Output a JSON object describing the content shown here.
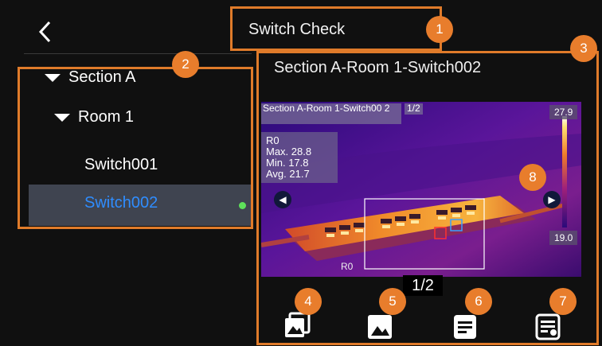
{
  "header": {
    "title": "Switch Check"
  },
  "sidebar": {
    "section_label": "Section A",
    "room_label": "Room 1",
    "devices": [
      "Switch001",
      "Switch002"
    ]
  },
  "detail": {
    "title": "Section A-Room 1-Switch002",
    "image_label": "Section A-Room 1-Switch00 2",
    "image_page": "1/2",
    "measurement": {
      "region": "R0",
      "max_label": "Max.",
      "max": "28.8",
      "min_label": "Min.",
      "min": "17.8",
      "avg_label": "Avg.",
      "avg": "21.7"
    },
    "scale_max": "27.9",
    "scale_min": "19.0",
    "region_tag": "R0",
    "page_indicator": "1/2"
  },
  "callouts": [
    "1",
    "2",
    "3",
    "4",
    "5",
    "6",
    "7",
    "8"
  ],
  "colors": {
    "accent": "#e87d2c",
    "selected_text": "#2f8dff",
    "status_dot": "#5ee05a"
  }
}
